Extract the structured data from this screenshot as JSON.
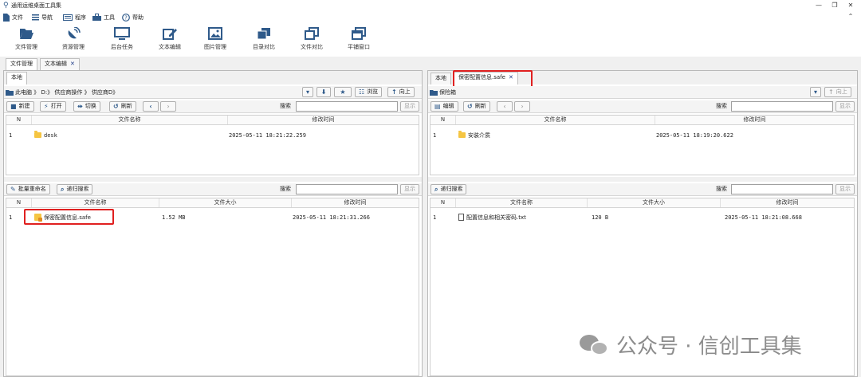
{
  "app": {
    "title": "通用运维桌面工具集"
  },
  "window_controls": {
    "minimize": "—",
    "restore": "❐",
    "close": "✕",
    "collapse": "⌃"
  },
  "menu": [
    {
      "icon": "file-icon",
      "label": "文件"
    },
    {
      "icon": "menu-lines-icon",
      "label": "导航"
    },
    {
      "icon": "keyboard-icon",
      "label": "程序"
    },
    {
      "icon": "toolbox-icon",
      "label": "工具"
    },
    {
      "icon": "help-icon",
      "label": "帮助"
    }
  ],
  "toolbar": [
    {
      "icon": "folder-open-icon",
      "label": "文件管理"
    },
    {
      "icon": "satellite-dish-icon",
      "label": "资源管理"
    },
    {
      "icon": "monitor-icon",
      "label": "后台任务"
    },
    {
      "icon": "edit-icon",
      "label": "文本编辑"
    },
    {
      "icon": "image-icon",
      "label": "图片管理"
    },
    {
      "icon": "copy-folders-icon",
      "label": "目录对比"
    },
    {
      "icon": "copy-files-icon",
      "label": "文件对比"
    },
    {
      "icon": "window-icon",
      "label": "平铺窗口"
    }
  ],
  "main_tabs": [
    {
      "label": "文件管理",
      "active": true
    },
    {
      "label": "文本编辑",
      "active": false,
      "closable": true
    }
  ],
  "left": {
    "tab": "本地",
    "path": "此电脑 》 D:》 供应商操作 》 供应商D》",
    "browse_label": "浏览",
    "up_label": "向上",
    "actions": {
      "new": "新建",
      "open": "打开",
      "switch": "切换",
      "refresh": "刷新"
    },
    "search_label": "搜索",
    "show_label": "显示",
    "columns": [
      "N",
      "文件名称",
      "修改时间"
    ],
    "rows": [
      {
        "n": "1",
        "name": "desk",
        "time": "2025-05-11 18:21:22.259"
      }
    ],
    "bottom": {
      "actions": {
        "batch_rename": "批量重命名",
        "recursive_search": "递归搜索"
      },
      "search_label": "搜索",
      "show_label": "显示",
      "columns": [
        "N",
        "文件名称",
        "文件大小",
        "修改时间"
      ],
      "rows": [
        {
          "n": "1",
          "name": "保密配置信息.safe",
          "size": "1.52 MB",
          "time": "2025-05-11 18:21:31.266"
        }
      ]
    }
  },
  "right": {
    "tabs": [
      {
        "label": "本地",
        "active": false
      },
      {
        "label": "保密配置信息.safe",
        "active": true,
        "closable": true
      }
    ],
    "path": "保险箱",
    "up_label": "向上",
    "actions": {
      "edit": "编辑",
      "refresh": "刷新"
    },
    "search_label": "搜索",
    "show_label": "显示",
    "columns": [
      "N",
      "文件名称",
      "修改时间"
    ],
    "rows": [
      {
        "n": "1",
        "name": "安装介质",
        "time": "2025-05-11 18:19:20.622"
      }
    ],
    "bottom": {
      "actions": {
        "recursive_search": "递归搜索"
      },
      "search_label": "搜索",
      "show_label": "显示",
      "columns": [
        "N",
        "文件名称",
        "文件大小",
        "修改时间"
      ],
      "rows": [
        {
          "n": "1",
          "name": "配置信息和相关密码.txt",
          "size": "120 B",
          "time": "2025-05-11 18:21:08.668"
        }
      ]
    }
  },
  "watermark": {
    "text": "公众号 · 信创工具集"
  },
  "colors": {
    "accent": "#2f5a8a",
    "highlight": "#e02020",
    "folder": "#f5c542"
  }
}
